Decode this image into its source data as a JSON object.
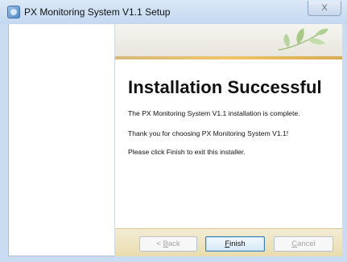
{
  "window": {
    "title": "PX Monitoring System V1.1 Setup",
    "close_glyph": "X"
  },
  "content": {
    "heading": "Installation Successful",
    "message1": "The PX Monitoring System V1.1  installation is complete.",
    "message2": "Thank you for choosing PX Monitoring System V1.1!",
    "message3": "Please click Finish to exit this installer."
  },
  "buttons": {
    "back": {
      "prefix": "< ",
      "accel": "B",
      "rest": "ack",
      "enabled": false
    },
    "finish": {
      "accel": "F",
      "rest": "inish",
      "enabled": true
    },
    "cancel": {
      "accel": "C",
      "rest": "ancel",
      "enabled": false
    }
  },
  "colors": {
    "banner_line": "#f0c46a",
    "footer": "#e9dcae"
  }
}
